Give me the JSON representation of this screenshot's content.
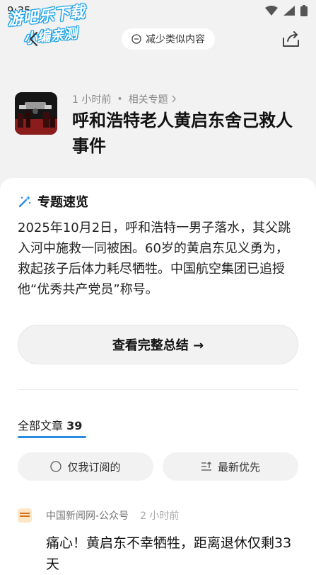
{
  "status_bar": {
    "time": "9:35"
  },
  "watermark": {
    "line1": "游吧乐下载",
    "line2": "小编亲测"
  },
  "header": {
    "reduce_label": "减少类似内容"
  },
  "topic": {
    "time": "1 小时前",
    "related_label": "相关专题",
    "title": "呼和浩特老人黄启东舍己救人事件"
  },
  "overview": {
    "heading": "专题速览",
    "text": "2025年10月2日，呼和浩特一男子落水，其父跳入河中施救一同被困。60岁的黄启东见义勇为，救起孩子后体力耗尽牺牲。中国航空集团已追授他“优秀共产党员”称号。",
    "summary_button": "查看完整总结 →"
  },
  "articles": {
    "tab_label": "全部文章",
    "count": "39",
    "filter_subscribed": "仅我订阅的",
    "filter_latest": "最新优先",
    "first": {
      "source": "中国新闻网-公众号",
      "time": "2 小时前",
      "title": "痛心！黄启东不幸牺牲，距离退休仅剩33天"
    }
  },
  "colors": {
    "accent": "#2a8be0",
    "page_bg": "#f2f2f2",
    "card_bg": "#ffffff"
  }
}
